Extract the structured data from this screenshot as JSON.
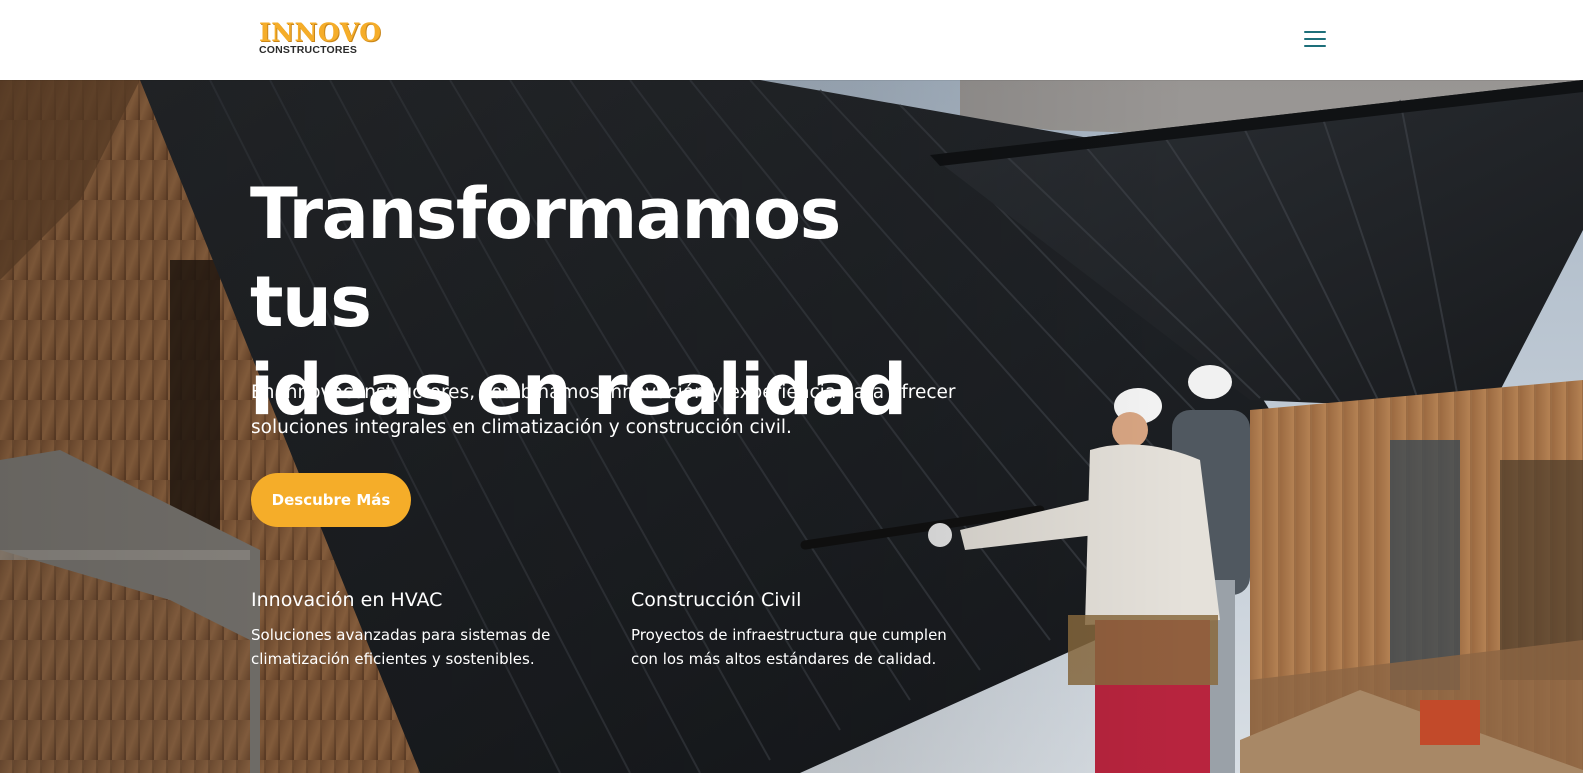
{
  "header": {
    "logo_top": "INNOVO",
    "logo_bottom": "CONSTRUCTORES",
    "menu_icon": "hamburger-menu-icon"
  },
  "hero": {
    "title_line1": "Transformamos tus",
    "title_line2": "ideas en realidad",
    "description": "En Innovoconstructores, combinamos innovación y experiencia para ofrecer soluciones integrales en climatización y construcción civil.",
    "cta_label": "Descubre Más",
    "features": [
      {
        "title": "Innovación en HVAC",
        "text": "Soluciones avanzadas para sistemas de climatización eficientes y sostenibles."
      },
      {
        "title": "Construcción Civil",
        "text": "Proyectos de infraestructura que cumplen con los más altos estándares de calidad."
      }
    ]
  },
  "colors": {
    "accent": "#f5ad29",
    "menu_icon": "#1d6f7a",
    "text_on_hero": "#ffffff"
  }
}
